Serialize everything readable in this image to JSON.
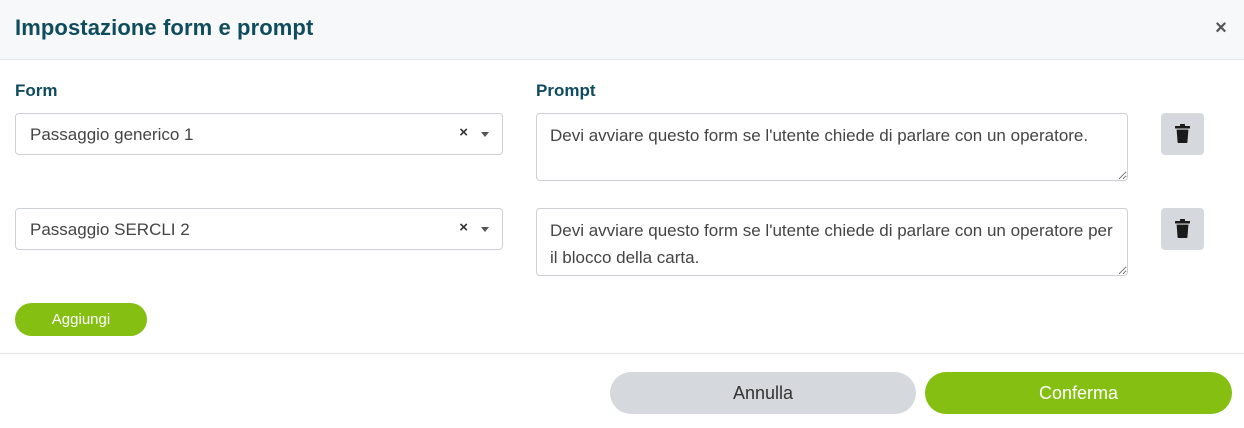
{
  "dialog": {
    "title": "Impostazione form e prompt",
    "close_icon": "×"
  },
  "columns": {
    "form_label": "Form",
    "prompt_label": "Prompt"
  },
  "rows": [
    {
      "form_value": "Passaggio generico 1",
      "clear_icon": "×",
      "prompt_text": "Devi avviare questo form se l'utente chiede di parlare con un operatore."
    },
    {
      "form_value": "Passaggio SERCLI 2",
      "clear_icon": "×",
      "prompt_text": "Devi avviare questo form se l'utente chiede di parlare con un operatore per il blocco della carta."
    }
  ],
  "actions": {
    "add_label": "Aggiungi",
    "cancel_label": "Annulla",
    "confirm_label": "Conferma"
  },
  "icons": {
    "close": "close-icon",
    "clear": "clear-icon",
    "caret": "chevron-down-icon",
    "delete": "trash-icon"
  },
  "colors": {
    "title": "#0f4c5c",
    "primary_green": "#84bf12",
    "neutral_button": "#d5d9dd"
  }
}
